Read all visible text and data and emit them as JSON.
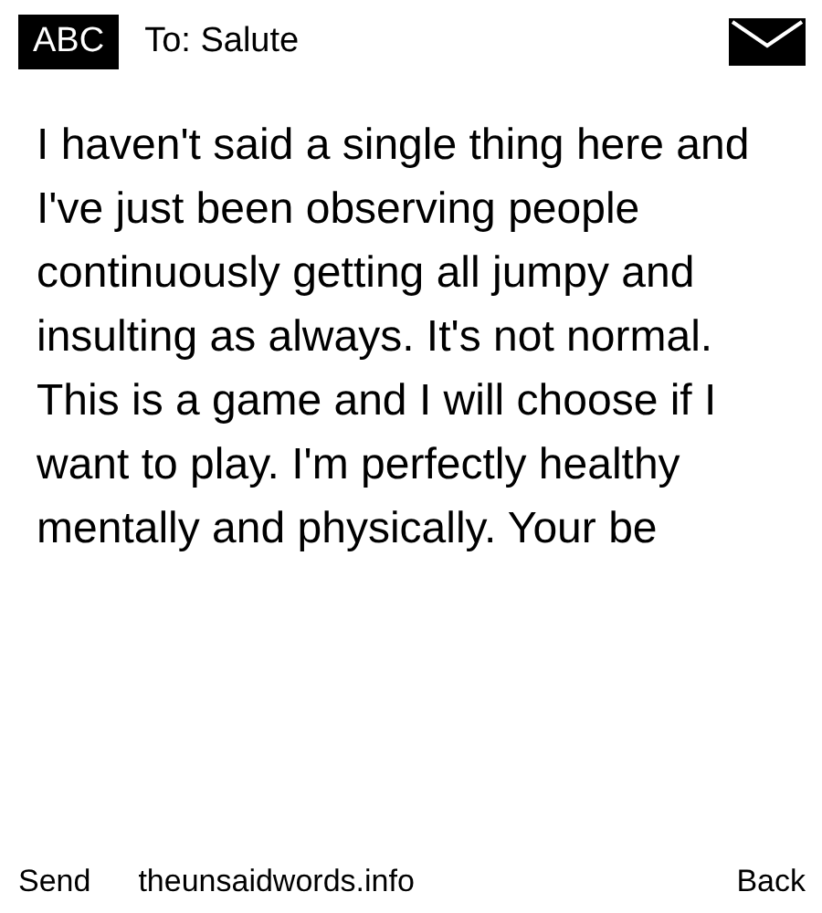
{
  "header": {
    "mode": "ABC",
    "recipient": "To: Salute"
  },
  "message": "I haven't said a single thing here and I've just been observing people continuously getting all jumpy and insulting as always. It's not normal. This is a game and I will choose if I want to play. I'm perfectly healthy mentally and physically. Your be",
  "softkeys": {
    "left": "Send",
    "center": "theunsaidwords.info",
    "right": "Back"
  }
}
